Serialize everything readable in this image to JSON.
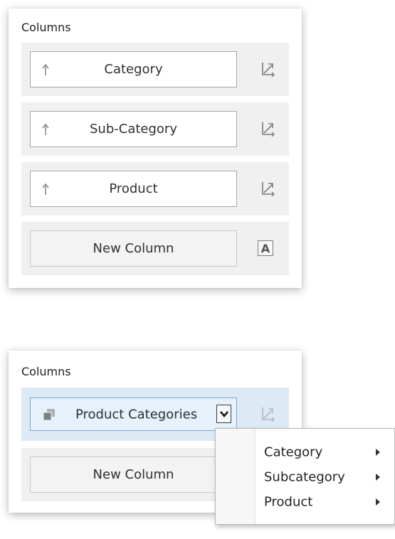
{
  "panel_top": {
    "title": "Columns",
    "rows": [
      {
        "label": "Category"
      },
      {
        "label": "Sub-Category"
      },
      {
        "label": "Product"
      }
    ],
    "new_column_label": "New Column",
    "new_column_icon": "A"
  },
  "panel_bottom": {
    "title": "Columns",
    "selected_field_label": "Product Categories",
    "new_column_label": "New Column"
  },
  "context_menu": {
    "items": [
      {
        "label": "Category"
      },
      {
        "label": "Subcategory"
      },
      {
        "label": "Product"
      }
    ]
  },
  "icons": {
    "sort": "arrow-up-icon",
    "column_type": "column-type-icon",
    "group": "hierarchy-icon",
    "dropdown": "chevron-down-icon",
    "submenu": "triangle-right-icon"
  },
  "colors": {
    "row_bg": "#f0f0f0",
    "selected_row_bg": "#dde9f5",
    "selected_field_bg": "#e6f1fc",
    "selected_field_border": "#7ea7d8"
  }
}
